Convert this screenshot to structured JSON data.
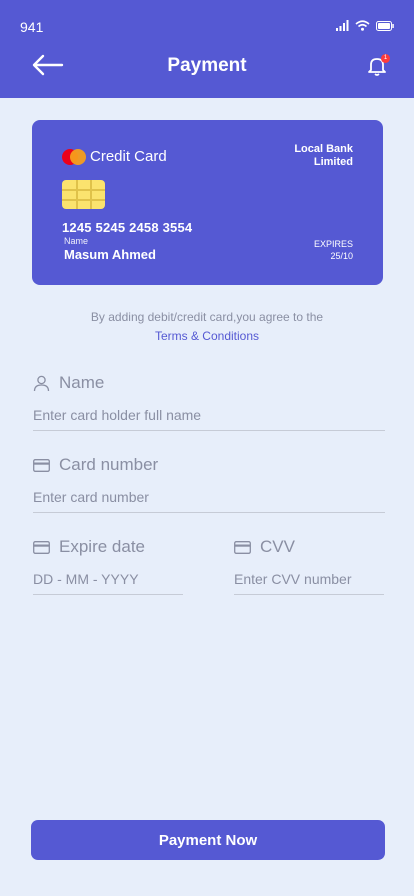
{
  "status_bar": {
    "time": "941"
  },
  "header": {
    "title": "Payment",
    "notification_count": "1"
  },
  "card": {
    "type_label": "Credit Card",
    "bank_name": "Local Bank Limited",
    "number": "1245 5245 2458 3554",
    "name_label": "Name",
    "holder_name": "Masum Ahmed",
    "expires_label": "EXPIRES",
    "expires_value": "25/10"
  },
  "agreement": {
    "text": "By adding debit/credit card,you agree to the",
    "link": "Terms & Conditions"
  },
  "form": {
    "name": {
      "label": "Name",
      "placeholder": "Enter card holder full name"
    },
    "card_number": {
      "label": "Card number",
      "placeholder": "Enter card number"
    },
    "expire_date": {
      "label": "Expire date",
      "placeholder": "DD - MM - YYYY"
    },
    "cvv": {
      "label": "CVV",
      "placeholder": "Enter CVV number"
    }
  },
  "actions": {
    "pay_label": "Payment Now"
  },
  "colors": {
    "primary": "#5559D3",
    "background": "#E7EEFA",
    "muted_text": "#8A8FA3",
    "chip": "#FBE36E"
  }
}
